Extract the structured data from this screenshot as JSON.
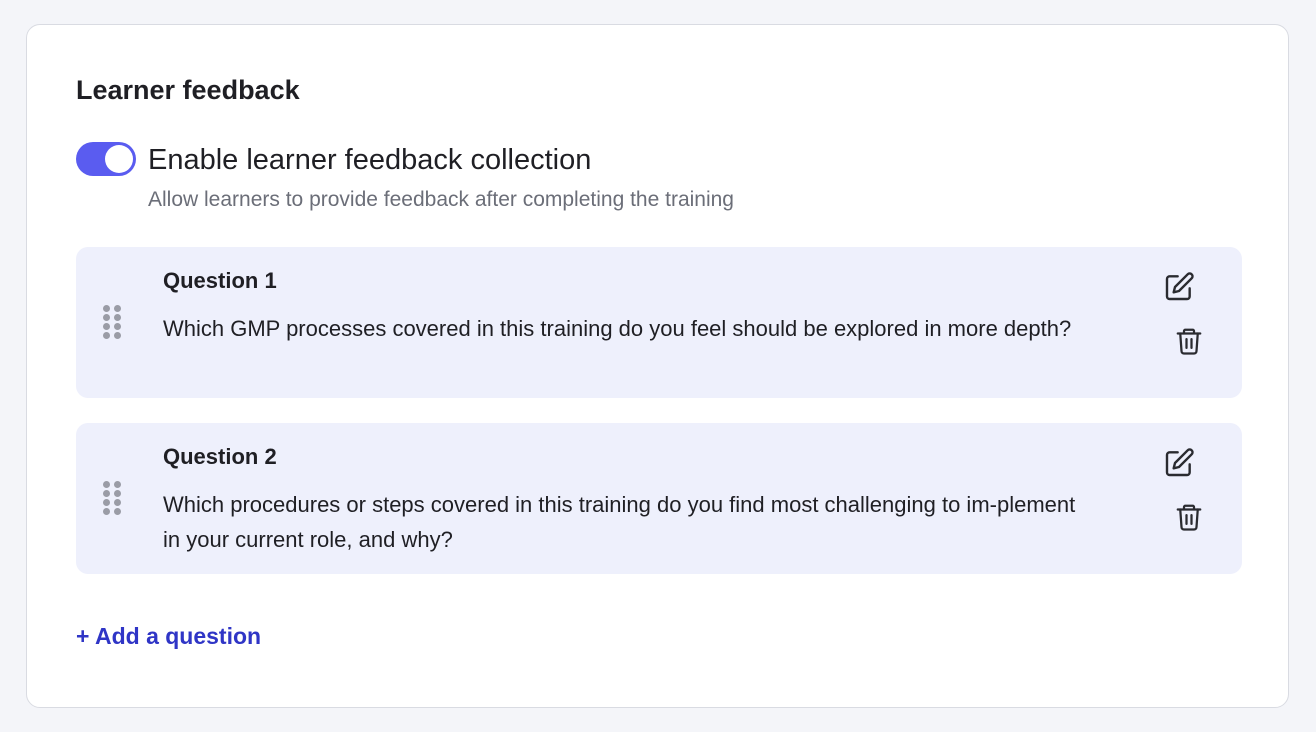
{
  "section": {
    "title": "Learner feedback"
  },
  "feedback_toggle": {
    "label": "Enable learner feedback collection",
    "description": "Allow learners to provide feedback after completing the training",
    "enabled": true,
    "accent_color": "#5a5cf0"
  },
  "questions": [
    {
      "title": "Question 1",
      "text": "Which GMP processes covered in this training do you feel should be explored in more depth?"
    },
    {
      "title": "Question 2",
      "text": "Which procedures or steps covered in this training do you find most challenging to im-plement in your current role, and why?"
    }
  ],
  "icons": {
    "drag": "drag-handle-icon",
    "edit": "pencil-square-icon",
    "delete": "trash-icon"
  },
  "actions": {
    "add_question_label": "+ Add a question",
    "link_color": "#2f35c6"
  }
}
